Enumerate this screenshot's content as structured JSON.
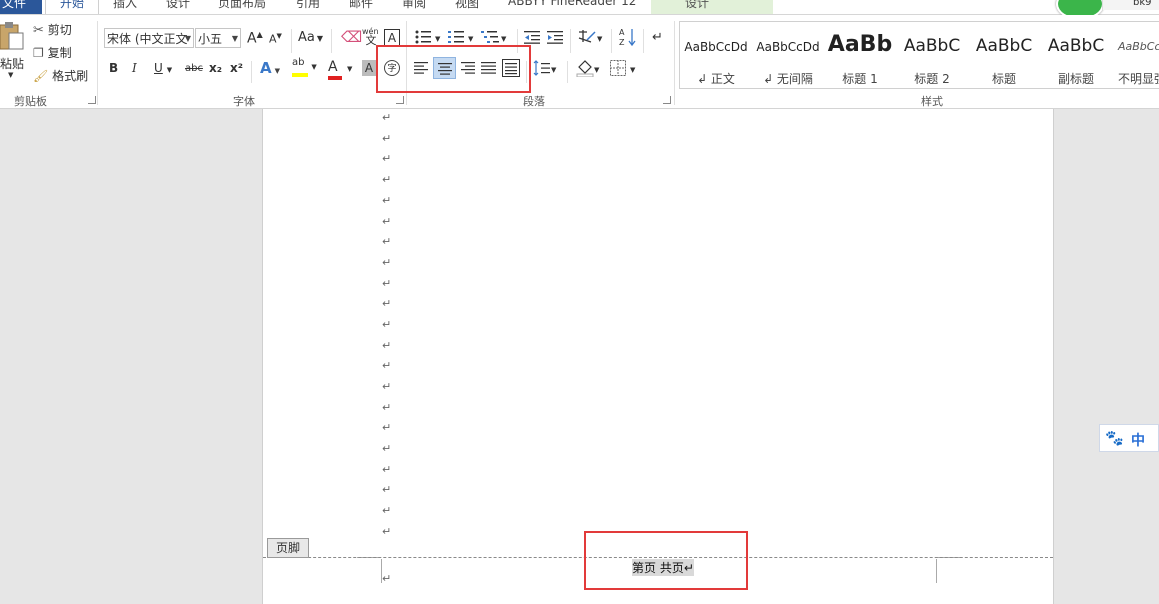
{
  "tabs": {
    "file": "文件",
    "home": "开始",
    "items": [
      "插入",
      "设计",
      "页面布局",
      "引用",
      "邮件",
      "审阅",
      "视图",
      "ABBYY FineReader 12"
    ],
    "context_design": "设计"
  },
  "clipboard": {
    "paste": "粘贴",
    "cut": "剪切",
    "copy": "复制",
    "format_painter": "格式刷",
    "group_label": "剪贴板"
  },
  "font": {
    "family": "宋体 (中文正文",
    "size": "小五",
    "group_label": "字体",
    "bold": "B",
    "italic": "I",
    "underline": "U",
    "strike": "abc",
    "subscript": "x₂",
    "superscript": "x²",
    "grow": "A",
    "shrink": "A",
    "case": "Aa",
    "highlight_letters": "ab",
    "font_color_letter": "A",
    "shade_letter": "A",
    "phonetic": "wén",
    "phonetic_char": "文",
    "border_char": "A",
    "enclose_char": "字"
  },
  "paragraph": {
    "group_label": "段落"
  },
  "styles": {
    "group_label": "样式",
    "items": [
      {
        "sample": "AaBbCcDd",
        "name": "↲ 正文"
      },
      {
        "sample": "AaBbCcDd",
        "name": "↲ 无间隔"
      },
      {
        "sample": "AaBb",
        "name": "标题 1"
      },
      {
        "sample": "AaBbC",
        "name": "标题 2"
      },
      {
        "sample": "AaBbC",
        "name": "标题"
      },
      {
        "sample": "AaBbC",
        "name": "副标题"
      },
      {
        "sample": "AaBbCcD",
        "name": "不明显强"
      }
    ]
  },
  "document": {
    "para_mark": "↵",
    "footer_tag": "页脚",
    "footer_text": "第页 共页↵"
  },
  "ime": {
    "label": "中"
  },
  "corner_panel": {
    "label": "bk9"
  },
  "colors": {
    "accent": "#2b579a",
    "highlight_box": "#e23a3a",
    "active_button": "#c5daf2"
  }
}
